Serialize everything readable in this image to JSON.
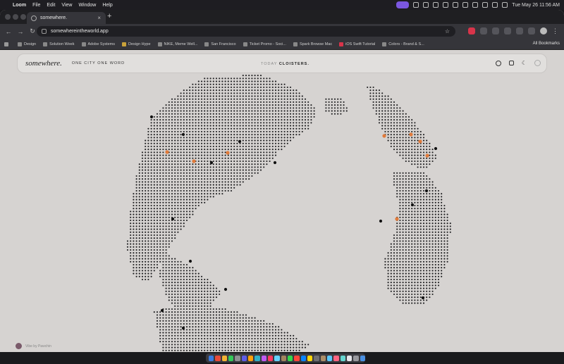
{
  "menubar": {
    "app": "Loom",
    "items": [
      "File",
      "Edit",
      "View",
      "Window",
      "Help"
    ],
    "ask_gemini": "Ask Gemini",
    "clock": "Tue May 26  11:56 AM"
  },
  "browser": {
    "tab_title": "somewhere.",
    "url": "somewhereintheworld.app",
    "bookmarks": [
      "Design",
      "Solution Week",
      "Adobe Systems",
      "Design Hype",
      "NIKE, Meme Well...",
      "San Francisco",
      "Ticket Promo - Soci...",
      "Spark Browse Mac",
      "iOS Swift Tutorial",
      "Colors - Brand & S..."
    ],
    "all_bookmarks": "All Bookmarks"
  },
  "site": {
    "logo": "somewhere.",
    "tagline": "ONE CITY ONE WORD",
    "today_label": "TODAY",
    "word_of_day": "CLOISTERS."
  },
  "icons": [
    "search-icon",
    "calendar-icon",
    "moon-icon",
    "loading-ring-icon"
  ],
  "credit": {
    "text": "Vibe by Pawchin"
  },
  "colors": {
    "accent": "#e07a3a",
    "dots": "#1b1b1d",
    "background": "#d6d3d1"
  }
}
